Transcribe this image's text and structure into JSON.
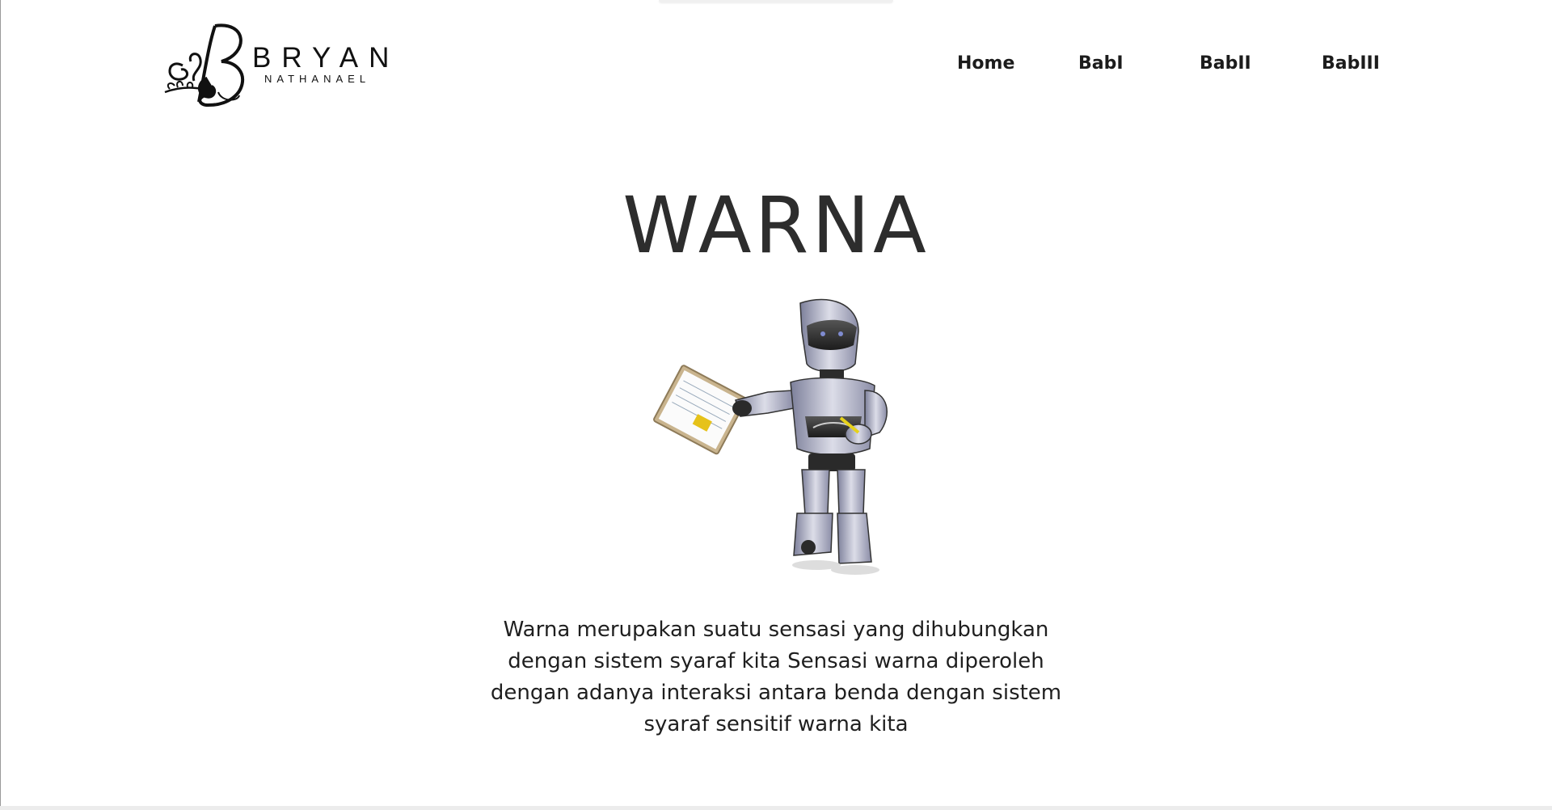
{
  "brand": {
    "name": "BRYAN",
    "subtitle": "NATHANAEL"
  },
  "nav": {
    "items": [
      {
        "label": "Home"
      },
      {
        "label": "BabI"
      },
      {
        "label": "BabII"
      },
      {
        "label": "BabIII"
      }
    ]
  },
  "main": {
    "title": "WARNA",
    "image_icon": "robot-with-clipboard-illustration",
    "description": "Warna merupakan suatu sensasi yang dihubungkan dengan sistem syaraf kita Sensasi warna diperoleh dengan adanya interaksi antara benda dengan sistem syaraf sensitif warna kita"
  },
  "colors": {
    "background": "#ffffff",
    "text": "#2d2d2d",
    "nav_text": "#1c1c1c"
  }
}
